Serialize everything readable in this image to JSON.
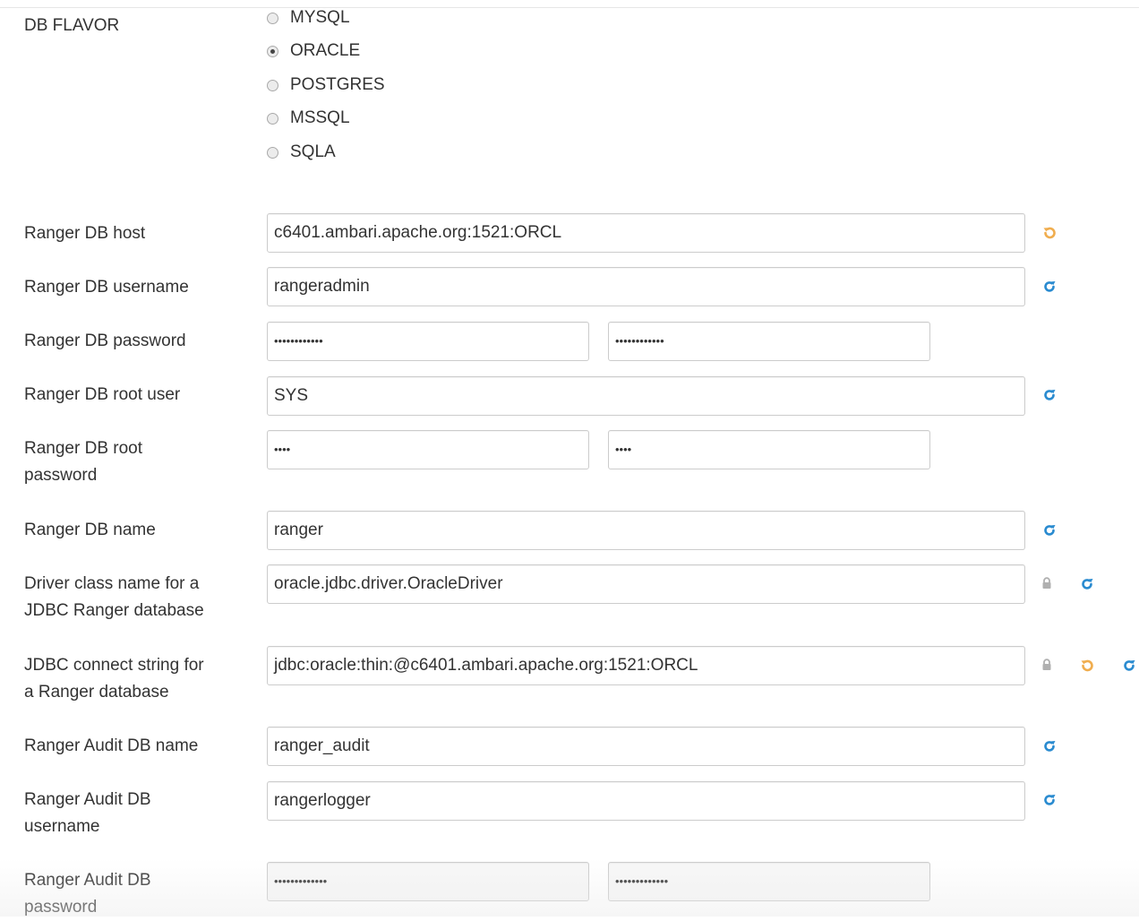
{
  "db_flavor": {
    "label": "DB FLAVOR",
    "options": [
      {
        "label": "MYSQL",
        "checked": false
      },
      {
        "label": "ORACLE",
        "checked": true
      },
      {
        "label": "POSTGRES",
        "checked": false
      },
      {
        "label": "MSSQL",
        "checked": false
      },
      {
        "label": "SQLA",
        "checked": false
      }
    ]
  },
  "fields": {
    "db_host": {
      "label": "Ranger DB host",
      "value": "c6401.ambari.apache.org:1521:ORCL"
    },
    "db_username": {
      "label": "Ranger DB username",
      "value": "rangeradmin"
    },
    "db_password": {
      "label": "Ranger DB password",
      "value": "••••••••••••",
      "confirm": "••••••••••••"
    },
    "db_root_user": {
      "label": "Ranger DB root user",
      "value": "SYS"
    },
    "db_root_password": {
      "label_line1": "Ranger DB root",
      "label_line2": "password",
      "value": "••••",
      "confirm": "••••"
    },
    "db_name": {
      "label": "Ranger DB name",
      "value": "ranger"
    },
    "driver_class": {
      "label_line1": "Driver class name for a",
      "label_line2": "JDBC Ranger database",
      "value": "oracle.jdbc.driver.OracleDriver"
    },
    "jdbc_connect": {
      "label_line1": "JDBC connect string for",
      "label_line2": "a Ranger database",
      "value": "jdbc:oracle:thin:@c6401.ambari.apache.org:1521:ORCL"
    },
    "audit_db_name": {
      "label": "Ranger Audit DB name",
      "value": "ranger_audit"
    },
    "audit_db_username": {
      "label_line1": "Ranger Audit DB",
      "label_line2": "username",
      "value": "rangerlogger"
    },
    "audit_db_password": {
      "label_line1": "Ranger Audit DB",
      "label_line2": "password",
      "value": "•••••••••••••",
      "confirm": "•••••••••••••"
    }
  },
  "colors": {
    "undo_icon": "#f0ad4e",
    "refresh_icon": "#2a8bd0",
    "lock_icon": "#b0b0b0"
  },
  "icons": {
    "undo": "undo-icon",
    "refresh": "refresh-icon",
    "lock": "lock-icon"
  }
}
